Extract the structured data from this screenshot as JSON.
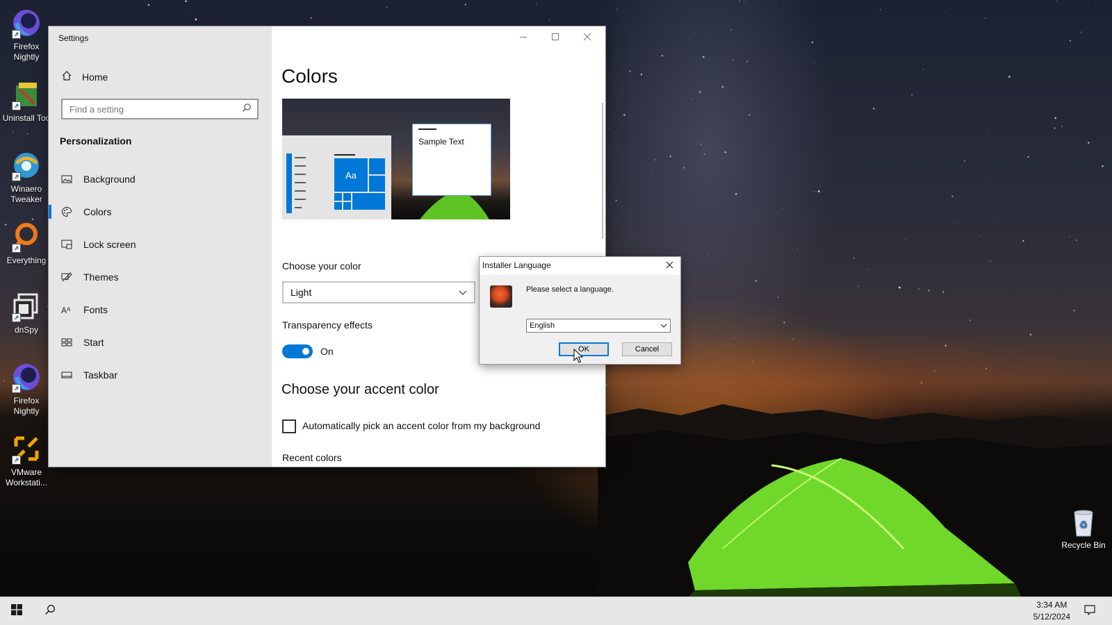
{
  "desktop": {
    "icons": [
      {
        "label": "Firefox Nightly",
        "icon": "firefox-nightly-icon"
      },
      {
        "label": "Uninstall Too",
        "icon": "uninstall-tool-icon"
      },
      {
        "label": "Winaero Tweaker",
        "icon": "winaero-tweaker-icon"
      },
      {
        "label": "Everything",
        "icon": "everything-search-icon"
      },
      {
        "label": "dnSpy",
        "icon": "dnspy-icon"
      },
      {
        "label": "Firefox Nightly",
        "icon": "firefox-nightly-icon"
      },
      {
        "label": "VMware Workstati...",
        "icon": "vmware-workstation-icon"
      }
    ],
    "recycle_bin": {
      "label": "Recycle Bin",
      "icon": "recycle-bin-icon"
    }
  },
  "settings": {
    "window_title": "Settings",
    "home_label": "Home",
    "search_placeholder": "Find a setting",
    "section_title": "Personalization",
    "nav_items": [
      {
        "label": "Background",
        "icon": "picture-icon"
      },
      {
        "label": "Colors",
        "icon": "palette-icon",
        "active": true
      },
      {
        "label": "Lock screen",
        "icon": "lock-screen-icon"
      },
      {
        "label": "Themes",
        "icon": "brush-icon"
      },
      {
        "label": "Fonts",
        "icon": "fonts-icon"
      },
      {
        "label": "Start",
        "icon": "start-grid-icon"
      },
      {
        "label": "Taskbar",
        "icon": "taskbar-icon"
      }
    ],
    "page_title": "Colors",
    "preview": {
      "tile_text": "Aa",
      "sample_text": "Sample Text"
    },
    "choose_color_label": "Choose your color",
    "choose_color_value": "Light",
    "transparency_label": "Transparency effects",
    "transparency_state": "On",
    "accent_title": "Choose your accent color",
    "auto_accent_label": "Automatically pick an accent color from my background",
    "auto_accent_checked": false,
    "recent_colors_label": "Recent colors"
  },
  "installer_dialog": {
    "title": "Installer Language",
    "message": "Please select a language.",
    "language_value": "English",
    "ok_label": "OK",
    "cancel_label": "Cancel"
  },
  "taskbar": {
    "time": "3:34 AM",
    "date": "5/12/2024"
  },
  "colors": {
    "accent": "#0078d7",
    "sidebar_bg": "#e6e6e6",
    "taskbar_bg": "#e7e7e7"
  }
}
